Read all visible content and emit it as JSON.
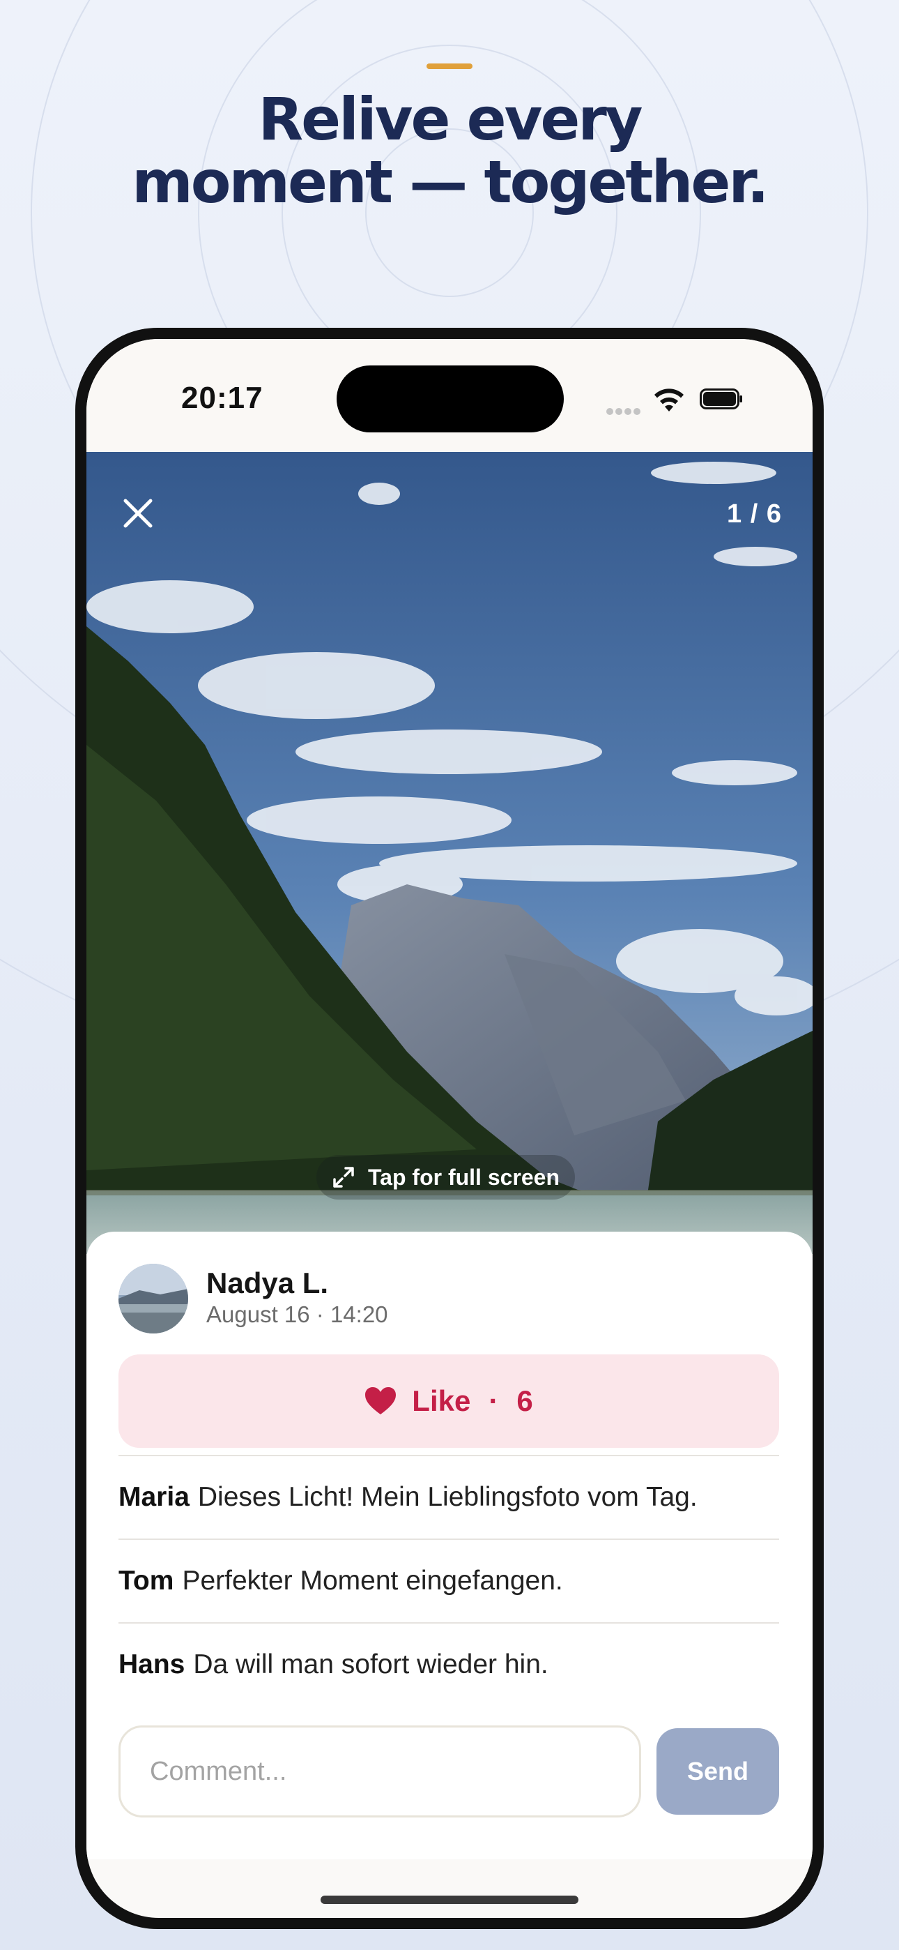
{
  "marketing": {
    "headline_line1": "Relive every",
    "headline_line2": "moment — together.",
    "accent_color": "#e0a03a",
    "headline_color": "#1c2a55"
  },
  "status_bar": {
    "time": "20:17",
    "icons": [
      "cellular-dots-icon",
      "wifi-icon",
      "battery-icon"
    ]
  },
  "viewer": {
    "close_icon": "close-icon",
    "photo_counter": "1 / 6",
    "fullscreen_label": "Tap for full screen",
    "fullscreen_icon": "expand-arrows-icon"
  },
  "post": {
    "author_name": "Nadya L.",
    "meta": "August 16 · 14:20",
    "like": {
      "label": "Like",
      "separator": "·",
      "count": "6",
      "color": "#c41f47"
    }
  },
  "comments": [
    {
      "author": "Maria",
      "text": "Dieses Licht! Mein Lieblingsfoto vom Tag."
    },
    {
      "author": "Tom",
      "text": "Perfekter Moment eingefangen."
    },
    {
      "author": "Hans",
      "text": "Da will man sofort wieder hin."
    }
  ],
  "composer": {
    "placeholder": "Comment...",
    "send_label": "Send",
    "send_color": "#9aa9c7"
  }
}
